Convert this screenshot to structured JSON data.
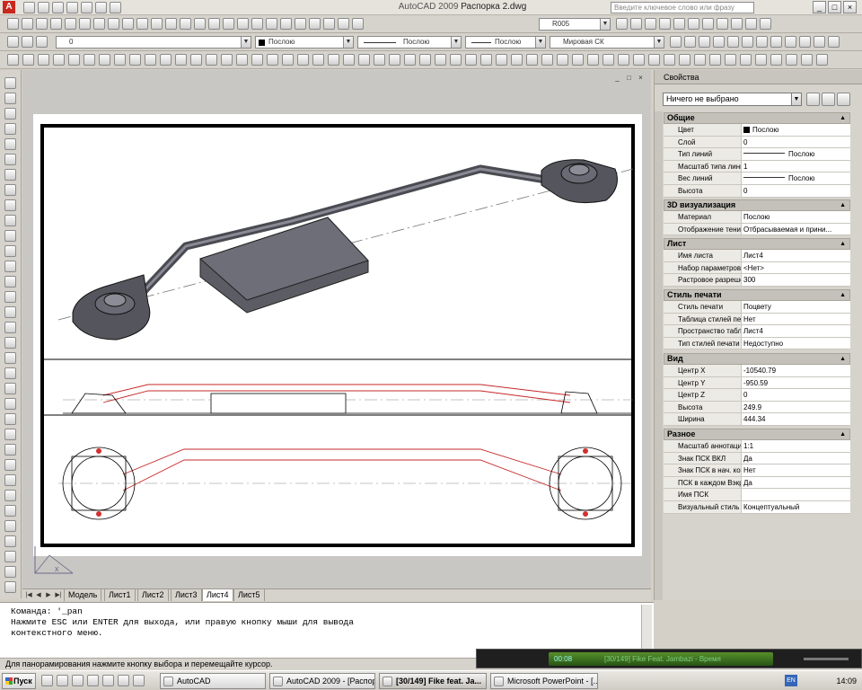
{
  "app": {
    "title_app": "AutoCAD 2009",
    "title_file": "Распорка 2.dwg",
    "logo_letter": "A",
    "search_placeholder": "Введите ключевое слово или фразу"
  },
  "toolbar": {
    "style_combo": "R005",
    "layer_combo": "0",
    "color_combo": "Послою",
    "linetype_combo": "Послою",
    "lineweight_combo": "Послою",
    "ucs_combo": "Мировая СК"
  },
  "drawing": {
    "window_controls": [
      "_",
      "□",
      "×"
    ]
  },
  "tabs": {
    "items": [
      {
        "label": "Модель",
        "active": false
      },
      {
        "label": "Лист1",
        "active": false
      },
      {
        "label": "Лист2",
        "active": false
      },
      {
        "label": "Лист3",
        "active": false
      },
      {
        "label": "Лист4",
        "active": true
      },
      {
        "label": "Лист5",
        "active": false
      }
    ]
  },
  "properties": {
    "title": "Свойства",
    "selection": "Ничего не выбрано",
    "sections": [
      {
        "name": "Общие",
        "rows": [
          {
            "key": "Цвет",
            "value": "Послою",
            "swatch": "#000000"
          },
          {
            "key": "Слой",
            "value": "0"
          },
          {
            "key": "Тип линий",
            "value": "Послою",
            "line": true
          },
          {
            "key": "Масштаб типа линий",
            "value": "1"
          },
          {
            "key": "Вес линий",
            "value": "Послою",
            "line": true
          },
          {
            "key": "Высота",
            "value": "0"
          }
        ]
      },
      {
        "name": "3D визуализация",
        "rows": [
          {
            "key": "Материал",
            "value": "Послою"
          },
          {
            "key": "Отображение тени",
            "value": "Отбрасываемая и прини..."
          }
        ]
      },
      {
        "name": "Лист",
        "rows": [
          {
            "key": "Имя листа",
            "value": "Лист4"
          },
          {
            "key": "Набор параметров ...",
            "value": "<Нет>"
          },
          {
            "key": "Растровое разреше...",
            "value": "300"
          }
        ]
      },
      {
        "name": "Стиль печати",
        "rows": [
          {
            "key": "Стиль печати",
            "value": "Поцвету"
          },
          {
            "key": "Таблица стилей пе...",
            "value": "Нет"
          },
          {
            "key": "Пространство табл...",
            "value": "Лист4"
          },
          {
            "key": "Тип стилей печати",
            "value": "Недоступно"
          }
        ]
      },
      {
        "name": "Вид",
        "rows": [
          {
            "key": "Центр X",
            "value": "-10540.79"
          },
          {
            "key": "Центр Y",
            "value": "-950.59"
          },
          {
            "key": "Центр Z",
            "value": "0"
          },
          {
            "key": "Высота",
            "value": "249.9"
          },
          {
            "key": "Ширина",
            "value": "444.34"
          }
        ]
      },
      {
        "name": "Разное",
        "rows": [
          {
            "key": "Масштаб аннотаций",
            "value": "1:1"
          },
          {
            "key": "Знак ПСК ВКЛ",
            "value": "Да"
          },
          {
            "key": "Знак ПСК в нач. ко...",
            "value": "Нет"
          },
          {
            "key": "ПСК в каждом Вэкр...",
            "value": "Да"
          },
          {
            "key": "Имя ПСК",
            "value": ""
          },
          {
            "key": "Визуальный стиль",
            "value": "Концептуальный"
          }
        ]
      }
    ]
  },
  "command": {
    "line1": "Команда: '_pan",
    "line2": "Нажмите ESC или ENTER для выхода, или правую кнопку мыши для вывода",
    "line3": "контекстного меню."
  },
  "status": {
    "text": "Для панорамирования нажмите кнопку выбора и перемещайте курсор."
  },
  "player": {
    "time": "00:08",
    "track": "[30/149] Fike Feat. Jambazi - Время"
  },
  "taskbar": {
    "start": "Пуск",
    "tasks": [
      {
        "label": "AutoCAD",
        "active": false
      },
      {
        "label": "AutoCAD 2009 - [Распор...",
        "active": false
      },
      {
        "label": "[30/149] Fike feat. Ja...",
        "active": true
      },
      {
        "label": "Microsoft PowerPoint - [...",
        "active": false
      }
    ],
    "lang": "EN",
    "clock": "14:09"
  }
}
